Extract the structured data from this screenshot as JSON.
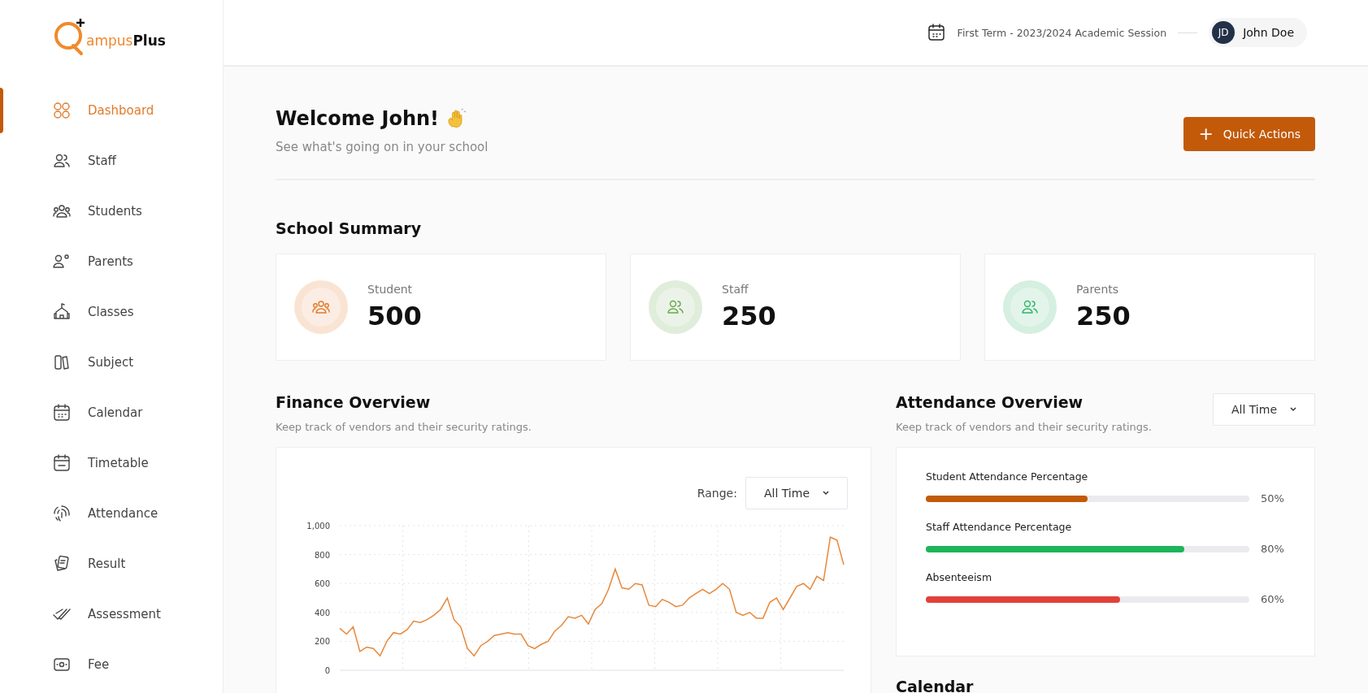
{
  "brand": {
    "name_part_1": "ampus",
    "name_part_2": "Plus"
  },
  "sidebar": {
    "items": [
      {
        "label": "Dashboard",
        "selected": true
      },
      {
        "label": "Staff",
        "selected": false
      },
      {
        "label": "Students",
        "selected": false
      },
      {
        "label": "Parents",
        "selected": false
      },
      {
        "label": "Classes",
        "selected": false
      },
      {
        "label": "Subject",
        "selected": false
      },
      {
        "label": "Calendar",
        "selected": false
      },
      {
        "label": "Timetable",
        "selected": false
      },
      {
        "label": "Attendance",
        "selected": false
      },
      {
        "label": "Result",
        "selected": false
      },
      {
        "label": "Assessment",
        "selected": false
      },
      {
        "label": "Fee",
        "selected": false
      }
    ]
  },
  "header": {
    "session": "First Term - 2023/2024 Academic Session",
    "user": {
      "initials": "JD",
      "name": "John Doe"
    }
  },
  "welcome": {
    "title": "Welcome John!",
    "subtitle": "See what's going on in your school",
    "quick_actions": {
      "icon": "+",
      "label": "Quick Actions"
    }
  },
  "summary": {
    "title": "School Summary",
    "cards": [
      {
        "label": "Student",
        "value": "500",
        "color": "#e07a2a"
      },
      {
        "label": "Staff",
        "value": "250",
        "color": "#6aa84f"
      },
      {
        "label": "Parents",
        "value": "250",
        "color": "#2fb36a"
      }
    ]
  },
  "finance": {
    "title": "Finance Overview",
    "subtitle": "Keep track of vendors and their security ratings.",
    "range_label": "Range:",
    "range_value": "All Time",
    "chart_data": {
      "type": "line",
      "grid": true,
      "ylim": [
        0,
        1000
      ],
      "yticks": [
        0,
        200,
        400,
        {
          "value": 600,
          "label": "600"
        },
        800,
        {
          "value": 1000,
          "label": "1,000"
        }
      ],
      "series": [
        {
          "color": "#e8883a",
          "values": [
            290,
            250,
            300,
            130,
            160,
            150,
            100,
            200,
            260,
            250,
            280,
            340,
            330,
            350,
            380,
            420,
            500,
            350,
            300,
            150,
            100,
            170,
            200,
            240,
            250,
            260,
            250,
            250,
            170,
            150,
            180,
            200,
            270,
            310,
            370,
            360,
            380,
            320,
            420,
            460,
            560,
            700,
            570,
            560,
            600,
            590,
            450,
            440,
            490,
            470,
            440,
            450,
            500,
            530,
            560,
            530,
            560,
            600,
            560,
            400,
            380,
            400,
            360,
            360,
            470,
            500,
            420,
            500,
            580,
            600,
            560,
            650,
            620,
            920,
            900,
            730
          ]
        }
      ]
    }
  },
  "attendance": {
    "title": "Attendance Overview",
    "subtitle": "Keep track of vendors and their security ratings.",
    "filter": "All Time",
    "metrics": [
      {
        "label": "Student Attendance Percentage",
        "level": 0.5,
        "reading": "50%",
        "color": "#c25a0a"
      },
      {
        "label": "Staff Attendance Percentage",
        "level": 0.8,
        "reading": "80%",
        "color": "#1db45a"
      },
      {
        "label": "Absenteeism",
        "level": 0.6,
        "reading": "60%",
        "color": "#e0413a"
      }
    ]
  },
  "calendar": {
    "title": "Calendar"
  }
}
